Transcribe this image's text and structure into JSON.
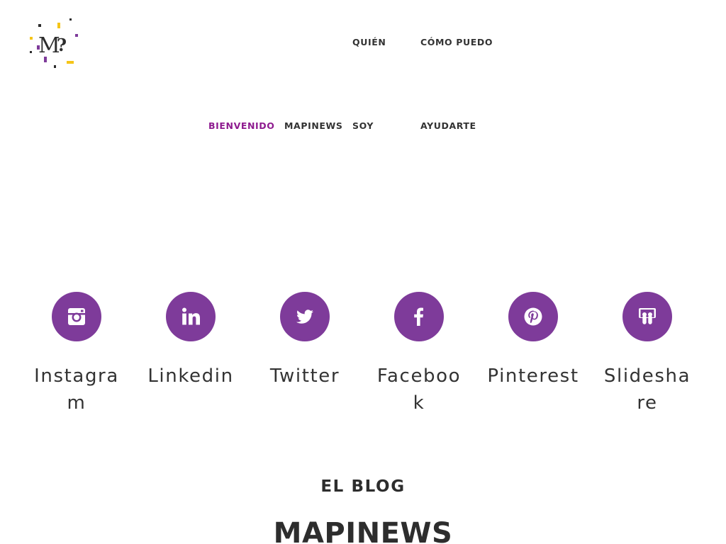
{
  "brand": {
    "logo_letter": "M",
    "logo_mark": "?",
    "colors": {
      "purple": "#7e3b9a",
      "magenta": "#8e1b8f",
      "yellow": "#f5c518",
      "ink": "#2d2d2d"
    }
  },
  "nav": {
    "items": [
      {
        "id": "bienvenido",
        "lines": [
          "BIENVENIDO"
        ],
        "active": true
      },
      {
        "id": "mapinews",
        "lines": [
          "MAPINEWS"
        ],
        "active": false
      },
      {
        "id": "quien-soy",
        "lines": [
          "QUIÉN",
          "SOY"
        ],
        "active": false
      },
      {
        "id": "como-puedo-ayudarte",
        "lines": [
          "CÓMO PUEDO",
          "AYUDARTE"
        ],
        "active": false
      }
    ]
  },
  "social": {
    "items": [
      {
        "label": "Instagram",
        "icon": "instagram-icon"
      },
      {
        "label": "Linkedin",
        "icon": "linkedin-icon"
      },
      {
        "label": "Twitter",
        "icon": "twitter-icon"
      },
      {
        "label": "Facebook",
        "icon": "facebook-icon"
      },
      {
        "label": "Pinterest",
        "icon": "pinterest-icon"
      },
      {
        "label": "Slideshare",
        "icon": "slideshare-icon"
      }
    ]
  },
  "blog": {
    "eyebrow": "EL BLOG",
    "title": "MAPINEWS"
  }
}
